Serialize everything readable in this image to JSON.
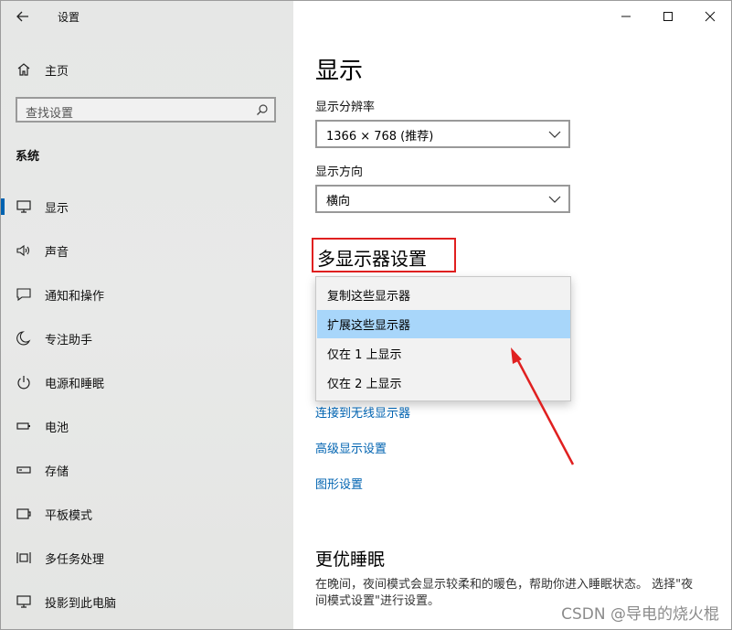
{
  "app": {
    "title": "设置"
  },
  "sidebar": {
    "home_label": "主页",
    "search_placeholder": "查找设置",
    "section_title": "系统",
    "items": [
      {
        "label": "显示",
        "icon": "monitor-icon",
        "active": true
      },
      {
        "label": "声音",
        "icon": "speaker-icon"
      },
      {
        "label": "通知和操作",
        "icon": "notification-icon"
      },
      {
        "label": "专注助手",
        "icon": "moon-icon"
      },
      {
        "label": "电源和睡眠",
        "icon": "power-icon"
      },
      {
        "label": "电池",
        "icon": "battery-icon"
      },
      {
        "label": "存储",
        "icon": "storage-icon"
      },
      {
        "label": "平板模式",
        "icon": "tablet-icon"
      },
      {
        "label": "多任务处理",
        "icon": "multitask-icon"
      },
      {
        "label": "投影到此电脑",
        "icon": "project-icon"
      }
    ]
  },
  "main": {
    "title": "显示",
    "resolution": {
      "label": "显示分辨率",
      "value": "1366 × 768 (推荐)"
    },
    "orientation": {
      "label": "显示方向",
      "value": "横向"
    },
    "multi_display": {
      "header": "多显示器设置",
      "options": [
        "复制这些显示器",
        "扩展这些显示器",
        "仅在 1 上显示",
        "仅在 2 上显示"
      ],
      "selected": "扩展这些显示器"
    },
    "links": [
      "连接到无线显示器",
      "高级显示设置",
      "图形设置"
    ],
    "sleep": {
      "title": "更优睡眠",
      "description": "在晚间，夜间模式会显示较柔和的暖色，帮助你进入睡眠状态。 选择\"夜间模式设置\"进行设置。"
    }
  },
  "watermark": "CSDN @导电的烧火棍",
  "colors": {
    "accent": "#0063b1",
    "highlight": "#a8d6fa",
    "annotation": "#e02020"
  }
}
